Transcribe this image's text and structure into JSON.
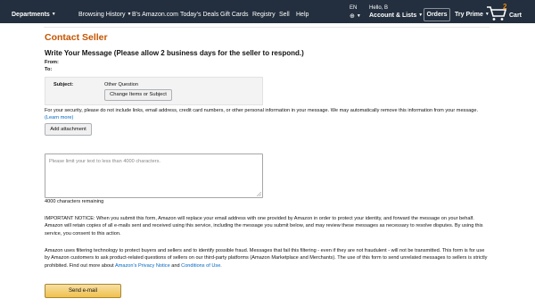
{
  "nav": {
    "departments": "Departments",
    "links": [
      "Browsing History",
      "B's Amazon.com",
      "Today's Deals",
      "Gift Cards",
      "Registry",
      "Sell",
      "Help"
    ],
    "language": "EN",
    "hello": "Hello, B",
    "account": "Account & Lists",
    "orders": "Orders",
    "prime": "Try Prime",
    "cart_count": "2",
    "cart_label": "Cart",
    "icons": [
      "globe-icon",
      "cart-icon",
      "caret-icon"
    ]
  },
  "page": {
    "title": "Contact Seller",
    "subtitle": "Write Your Message (Please allow 2 business days for the seller to respond.)",
    "from_label": "From:",
    "to_label": "To:",
    "subject_label": "Subject:",
    "subject_value": "Other Question",
    "change_button": "Change Items or Subject",
    "security_note": "For your security, please do not include links, email address, credit card numbers, or other personal information in your message. We may automatically remove this information from your message.",
    "learn_more": "(Learn more)",
    "attach_button": "Add attachment",
    "message_placeholder": "Please limit your text to less than 4000 characters.",
    "chars_remaining": "4000 characters remaining",
    "notice": "IMPORTANT NOTICE: When you submit this form, Amazon will replace your email address with one provided by Amazon in order to protect your identity, and forward the message on your behalf. Amazon will retain copies of all e-mails sent and received using this service, including the message you submit below, and may review these messages as necessary to resolve disputes. By using this service, you consent to this action.",
    "filter_text": "Amazon uses filtering technology to protect buyers and sellers and to identify possible fraud. Messages that fail this filtering - even if they are not fraudulent - will not be transmitted. This form is for use by Amazon customers to ask product-related questions of sellers on our third-party platforms (Amazon Marketplace and Merchants). The use of this form to send unrelated messages to sellers is strictly prohibited. Find out more about",
    "privacy_link": "Amazon's Privacy Notice",
    "and_text": "and",
    "conditions_link": "Conditions of Use.",
    "send_button": "Send e-mail"
  },
  "colors": {
    "nav_bg": "#232f3e",
    "title": "#c45500",
    "link": "#0066c0",
    "cart_badge": "#f08804"
  }
}
